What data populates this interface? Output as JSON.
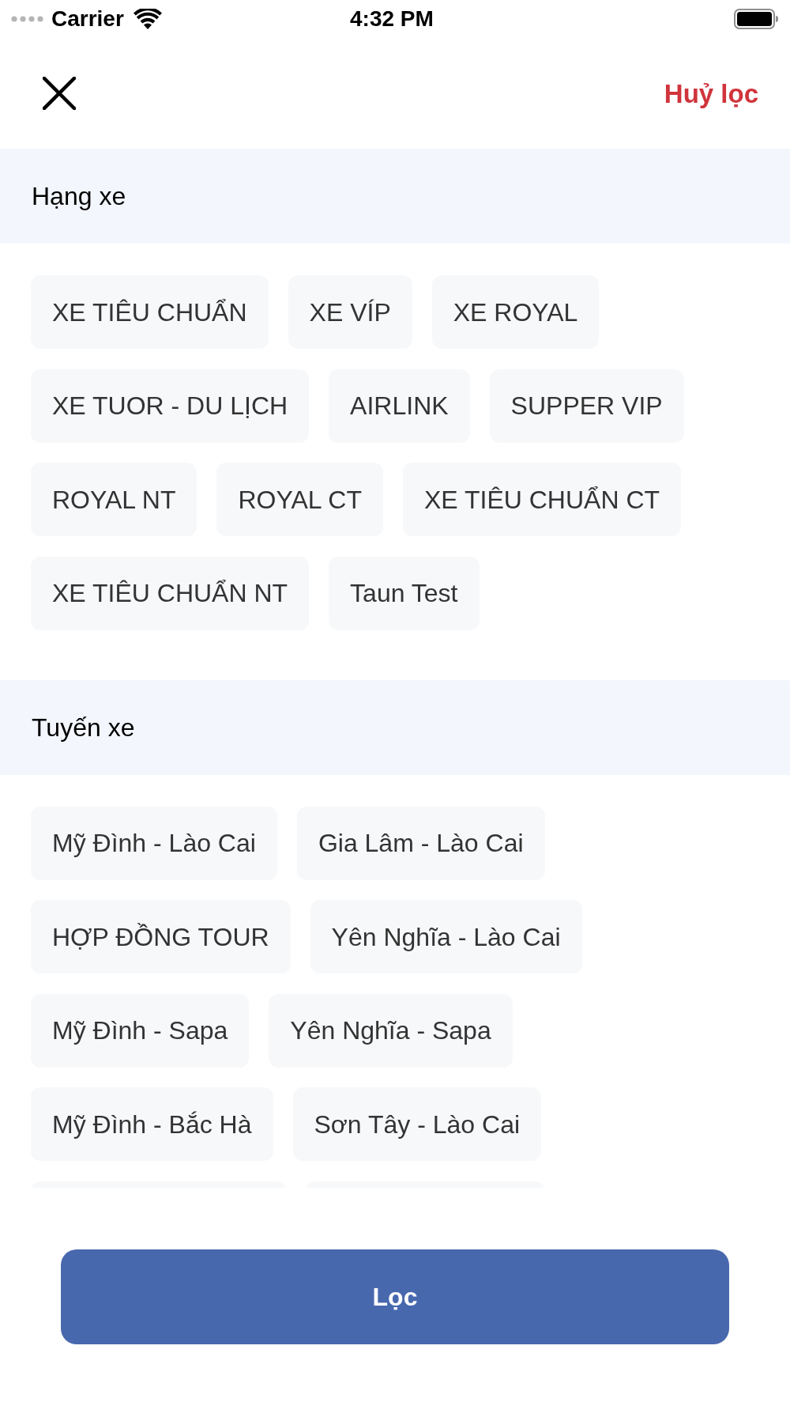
{
  "status_bar": {
    "carrier": "Carrier",
    "time": "4:32 PM"
  },
  "header": {
    "cancel_filter": "Huỷ lọc"
  },
  "sections": [
    {
      "title": "Hạng xe",
      "chips": [
        {
          "kind": "chip",
          "label": "XE TIÊU CHUẨN"
        },
        {
          "kind": "chip",
          "label": "XE VÍP"
        },
        {
          "kind": "chip",
          "label": "XE ROYAL"
        },
        {
          "kind": "chip",
          "label": "XE TUOR - DU LỊCH"
        },
        {
          "kind": "chip",
          "label": "AIRLINK"
        },
        {
          "kind": "chip",
          "label": "SUPPER VIP"
        },
        {
          "kind": "chip",
          "label": "ROYAL NT"
        },
        {
          "kind": "chip",
          "label": "ROYAL CT"
        },
        {
          "kind": "chip",
          "label": "XE TIÊU CHUẨN CT"
        },
        {
          "kind": "chip",
          "label": "XE TIÊU CHUẨN NT"
        },
        {
          "kind": "chip",
          "label": "Taun Test"
        }
      ]
    },
    {
      "title": "Tuyến xe",
      "chips": [
        {
          "kind": "chip",
          "label": "Mỹ Đình - Lào Cai"
        },
        {
          "kind": "chip",
          "label": "Gia Lâm - Lào Cai"
        },
        {
          "kind": "chip",
          "label": "HỢP ĐỒNG TOUR"
        },
        {
          "kind": "chip",
          "label": "Yên Nghĩa - Lào Cai"
        },
        {
          "kind": "chip",
          "label": "Mỹ Đình - Sapa"
        },
        {
          "kind": "chip",
          "label": "Yên Nghĩa - Sapa"
        },
        {
          "kind": "chip",
          "label": "Mỹ Đình - Bắc Hà"
        },
        {
          "kind": "chip",
          "label": "Sơn Tây - Lào Cai"
        },
        {
          "kind": "clipped"
        },
        {
          "kind": "clipped"
        }
      ]
    }
  ],
  "apply_button": "Lọc"
}
